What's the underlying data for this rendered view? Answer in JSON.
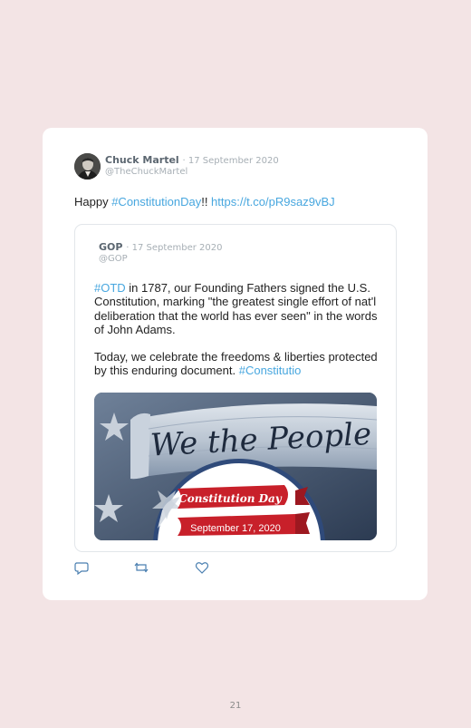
{
  "tweet": {
    "author_name": "Chuck Martel",
    "date": "· 17 September 2020",
    "handle": "@TheChuckMartel",
    "text_prefix": "Happy ",
    "hashtag": "#ConstitutionDay",
    "text_mid": "!! ",
    "link": "https://t.co/pR9saz9vBJ"
  },
  "quoted": {
    "author_name": "GOP",
    "date": "· 17 September 2020",
    "handle": "@GOP",
    "hashtag_start": "#OTD",
    "para1_rest": " in 1787, our Founding Fathers signed the U.S. Constitution, marking \"the greatest single effort of nat'l deliberation that the world has ever seen\" in the words of John Adams.",
    "para2_text": "Today, we celebrate the freedoms & liberties protected by this enduring document. ",
    "hashtag_end": "#Constitutio",
    "image": {
      "document_text": "We the People",
      "banner_title": "Constitution Day",
      "banner_date": "September 17, 2020"
    }
  },
  "actions": {
    "reply_icon": "reply-icon",
    "retweet_icon": "retweet-icon",
    "like_icon": "heart-icon"
  },
  "page_number": "21",
  "colors": {
    "background": "#f3e4e5",
    "link": "#48a7df",
    "banner_red": "#c8202a",
    "navy": "#2f4a7a"
  }
}
